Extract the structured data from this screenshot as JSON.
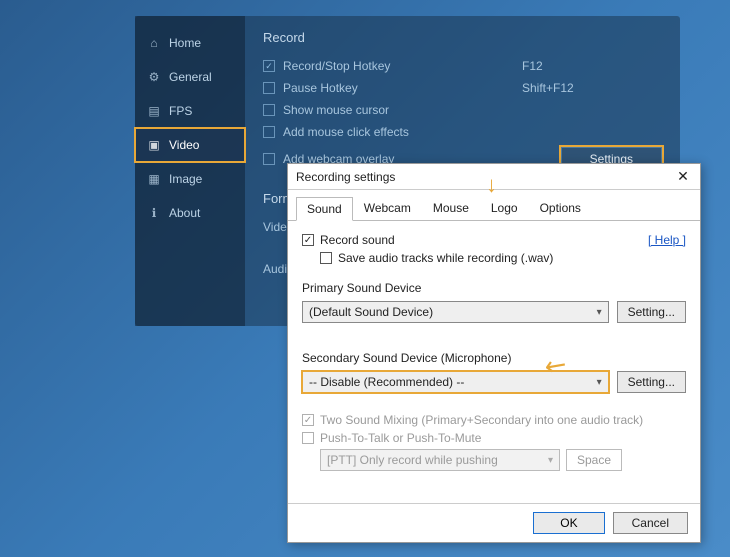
{
  "sidebar": {
    "items": [
      {
        "label": "Home"
      },
      {
        "label": "General"
      },
      {
        "label": "FPS"
      },
      {
        "label": "Video"
      },
      {
        "label": "Image"
      },
      {
        "label": "About"
      }
    ]
  },
  "record": {
    "title": "Record",
    "rows": [
      {
        "label": "Record/Stop Hotkey",
        "value": "F12",
        "checked": true
      },
      {
        "label": "Pause Hotkey",
        "value": "Shift+F12",
        "checked": false
      },
      {
        "label": "Show mouse cursor",
        "value": "",
        "checked": false
      },
      {
        "label": "Add mouse click effects",
        "value": "",
        "checked": false
      },
      {
        "label": "Add webcam overlay",
        "value": "",
        "checked": false
      }
    ],
    "settings_btn": "Settings",
    "format_title": "Format",
    "format_video": "Video",
    "format_audio": "Audio"
  },
  "dialog": {
    "title": "Recording settings",
    "tabs": [
      "Sound",
      "Webcam",
      "Mouse",
      "Logo",
      "Options"
    ],
    "record_sound": "Record sound",
    "save_tracks": "Save audio tracks while recording (.wav)",
    "help": "[ Help ]",
    "primary_label": "Primary Sound Device",
    "primary_value": "(Default Sound Device)",
    "secondary_label": "Secondary Sound Device (Microphone)",
    "secondary_value": "-- Disable (Recommended) --",
    "setting_btn": "Setting...",
    "two_mix": "Two Sound Mixing (Primary+Secondary into one audio track)",
    "ptt": "Push-To-Talk or Push-To-Mute",
    "ptt_mode": "[PTT] Only record while pushing",
    "ptt_key": "Space",
    "ok": "OK",
    "cancel": "Cancel"
  }
}
